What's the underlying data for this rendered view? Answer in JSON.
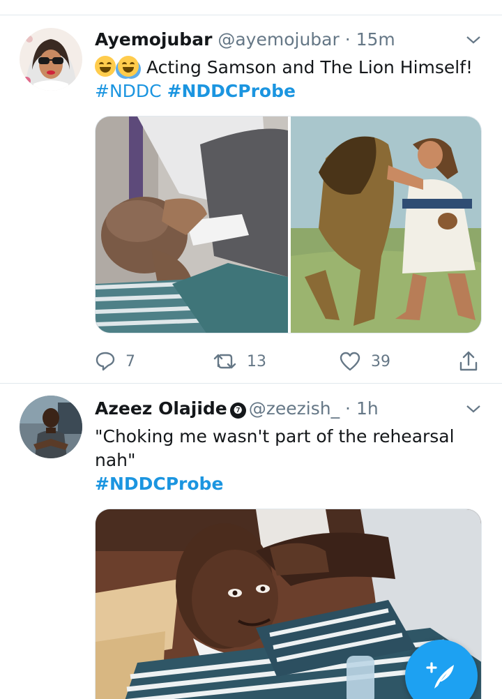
{
  "tweets": [
    {
      "display_name": "Ayemojubar",
      "handle": "@ayemojubar",
      "separator": "·",
      "time": "15m",
      "text": "Acting Samson and The Lion Himself!",
      "hashtags": [
        "#NDDC",
        "#NDDCProbe"
      ],
      "reply_count": "7",
      "retweet_count": "13",
      "like_count": "39",
      "icons": [
        "reply-icon",
        "retweet-icon",
        "like-icon",
        "share-icon",
        "chevron-down-icon"
      ]
    },
    {
      "display_name": "Azeez Olajide",
      "handle": "@zeezish_",
      "separator": "·",
      "time": "1h",
      "verified_glyph": "❼",
      "text": "\"Choking me wasn't part of the rehearsal nah\"",
      "hashtags": [
        "#NDDCProbe"
      ],
      "icons": [
        "verified-badge-icon",
        "chevron-down-icon"
      ]
    }
  ],
  "fab": {
    "icon": "compose-tweet-icon"
  },
  "colors": {
    "link": "#1b95e0",
    "accent": "#1da1f2",
    "muted": "#657786",
    "text": "#14171a",
    "divider": "#e1e8ed"
  }
}
